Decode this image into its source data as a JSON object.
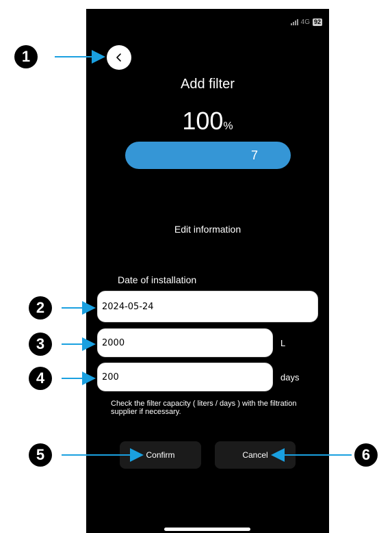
{
  "status": {
    "network": "4G",
    "battery": "92"
  },
  "page": {
    "title": "Add filter",
    "percent": "100",
    "percent_unit": "%",
    "progress_value": "7",
    "progress_fill": 1.0
  },
  "section": {
    "edit_label": "Edit information"
  },
  "form": {
    "date_label": "Date of installation",
    "date_value": "2024-05-24",
    "liters_value": "2000",
    "liters_unit": "L",
    "days_value": "200",
    "days_unit": "days",
    "hint": "Check the filter capacity ( liters / days ) with the filtration supplier if necessary."
  },
  "buttons": {
    "confirm": "Confirm",
    "cancel": "Cancel"
  },
  "markers": [
    "1",
    "2",
    "3",
    "4",
    "5",
    "6"
  ],
  "colors": {
    "accent": "#3596d6",
    "annotation_arrow": "#1aa0e0",
    "background": "#000000"
  },
  "icons": {
    "back": "chevron-left-icon"
  }
}
